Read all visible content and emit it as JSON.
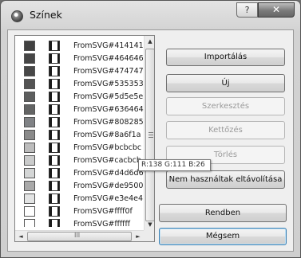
{
  "window": {
    "title": "Színek",
    "help_glyph": "?",
    "close_glyph": "✕"
  },
  "colors": [
    {
      "name": "FromSVG#414141",
      "color": "#414141"
    },
    {
      "name": "FromSVG#464646",
      "color": "#464646"
    },
    {
      "name": "FromSVG#474747",
      "color": "#474747"
    },
    {
      "name": "FromSVG#535353",
      "color": "#535353"
    },
    {
      "name": "FromSVG#5d5e5e",
      "color": "#5d5e5e"
    },
    {
      "name": "FromSVG#636464",
      "color": "#636464"
    },
    {
      "name": "FromSVG#808285",
      "color": "#808285"
    },
    {
      "name": "FromSVG#8a6f1a",
      "color": "#8a8a8a"
    },
    {
      "name": "FromSVG#bcbcbc",
      "color": "#bcbcbc"
    },
    {
      "name": "FromSVG#cacbcb",
      "color": "#cacbcb"
    },
    {
      "name": "FromSVG#d4d6d6",
      "color": "#d4d6d6"
    },
    {
      "name": "FromSVG#de9500",
      "color": "#a9a9a9"
    },
    {
      "name": "FromSVG#e3e4e4",
      "color": "#e3e4e4"
    },
    {
      "name": "FromSVG#ffff0f",
      "color": "#ffffff"
    },
    {
      "name": "FromSVG#ffffff",
      "color": "#ffffff"
    }
  ],
  "list_scrollbar": {
    "up_glyph": "▲",
    "down_glyph": "▼",
    "left_glyph": "◄",
    "right_glyph": "►",
    "grip": "III"
  },
  "buttons": {
    "import": "Importálás",
    "new": "Új",
    "edit": "Szerkesztés",
    "duplicate": "Kettőzés",
    "delete": "Törlés",
    "remove_unused": "Nem használtak eltávolítása",
    "ok": "Rendben",
    "cancel": "Mégsem"
  },
  "tooltip": {
    "text": "R:138 G:111 B:26"
  }
}
